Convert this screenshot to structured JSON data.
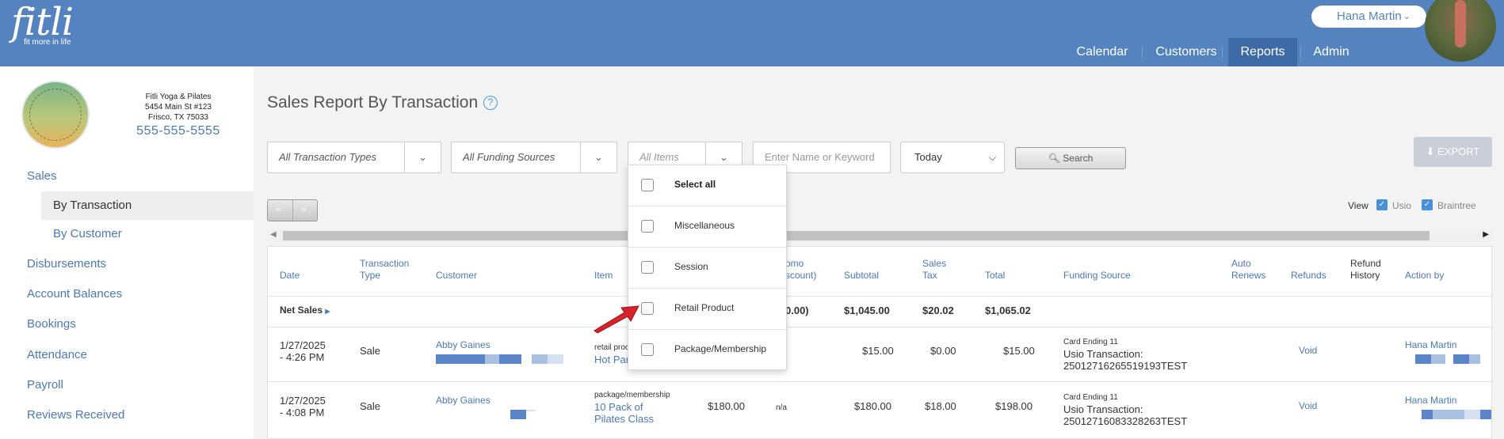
{
  "app": {
    "logo_text": "fitli",
    "logo_tagline": "fit more in life",
    "user_name": "Hana Martin",
    "chevron": "»"
  },
  "nav": {
    "items": [
      "Calendar",
      "Customers",
      "Reports",
      "Admin"
    ],
    "active": "Reports"
  },
  "studio": {
    "name": "Fitli Yoga & Pilates",
    "address1": "5454 Main St #123",
    "address2": "Frisco, TX 75033",
    "phone": "555-555-5555",
    "logo_text": "FITLI YOGA & PILATES"
  },
  "sidebar": {
    "items": [
      {
        "label": "Sales"
      },
      {
        "label": "By Transaction",
        "sub": true,
        "active": true
      },
      {
        "label": "By Customer",
        "sub": true
      },
      {
        "label": "Disbursements"
      },
      {
        "label": "Account Balances"
      },
      {
        "label": "Bookings"
      },
      {
        "label": "Attendance"
      },
      {
        "label": "Payroll"
      },
      {
        "label": "Reviews Received"
      }
    ]
  },
  "page": {
    "title": "Sales Report By Transaction",
    "help_icon": "?"
  },
  "filters": {
    "transaction_types": "All Transaction Types",
    "funding_sources": "All Funding Sources",
    "items": "All Items",
    "keyword_placeholder": "Enter Name or Keyword",
    "date": "Today",
    "search_label": "Search",
    "export_label": "EXPORT"
  },
  "pager": {
    "prev": "«",
    "next": "»"
  },
  "view": {
    "label": "View",
    "options": [
      {
        "label": "Usio",
        "checked": true
      },
      {
        "label": "Braintree",
        "checked": true
      }
    ]
  },
  "items_dropdown": {
    "options": [
      {
        "label": "Select all",
        "bold": true,
        "checked": false
      },
      {
        "label": "Miscellaneous",
        "checked": false
      },
      {
        "label": "Session",
        "checked": false
      },
      {
        "label": "Retail Product",
        "checked": false
      },
      {
        "label": "Package/Membership",
        "checked": false
      }
    ]
  },
  "table": {
    "columns": {
      "date": "Date",
      "type1": "Transaction",
      "type2": "Type",
      "customer": "Customer",
      "item": "Item",
      "promo1": "omo",
      "promo2": "scount)",
      "subtotal": "Subtotal",
      "tax1": "Sales",
      "tax2": "Tax",
      "total": "Total",
      "funding": "Funding Source",
      "renews1": "Auto",
      "renews2": "Renews",
      "refunds": "Refunds",
      "history1": "Refund",
      "history2": "History",
      "action": "Action by"
    },
    "net_sales": {
      "label": "Net Sales",
      "promo": "0.00)",
      "subtotal": "$1,045.00",
      "tax": "$20.02",
      "total": "$1,065.02"
    },
    "rows": [
      {
        "date1": "1/27/2025",
        "date2": "- 4:26 PM",
        "type": "Sale",
        "customer": "Abby Gaines",
        "item_cat": "retail proc",
        "item_name": "Hot Pan",
        "price": "",
        "promo": "",
        "subtotal": "$15.00",
        "tax": "$0.00",
        "total": "$15.00",
        "card": "Card Ending 11",
        "txn1": "Usio Transaction:",
        "txn2": "25012716265519193TEST",
        "refund": "Void",
        "action": "Hana Martin"
      },
      {
        "date1": "1/27/2025",
        "date2": "- 4:08 PM",
        "type": "Sale",
        "customer": "Abby Gaines",
        "item_cat": "package/membership",
        "item_name1": "10 Pack of",
        "item_name2": "Pilates Class",
        "price": "$180.00",
        "promo": "n/a",
        "subtotal": "$180.00",
        "tax": "$18.00",
        "total": "$198.00",
        "card": "Card Ending 11",
        "txn1": "Usio Transaction:",
        "txn2": "25012716083328263TEST",
        "refund": "Void",
        "action": "Hana Martin"
      }
    ]
  },
  "colors": {
    "brand_blue": "#5483c0",
    "nav_active": "#3f6aa8",
    "link_blue": "#4a78b8",
    "pointer_red": "#d8232a"
  }
}
